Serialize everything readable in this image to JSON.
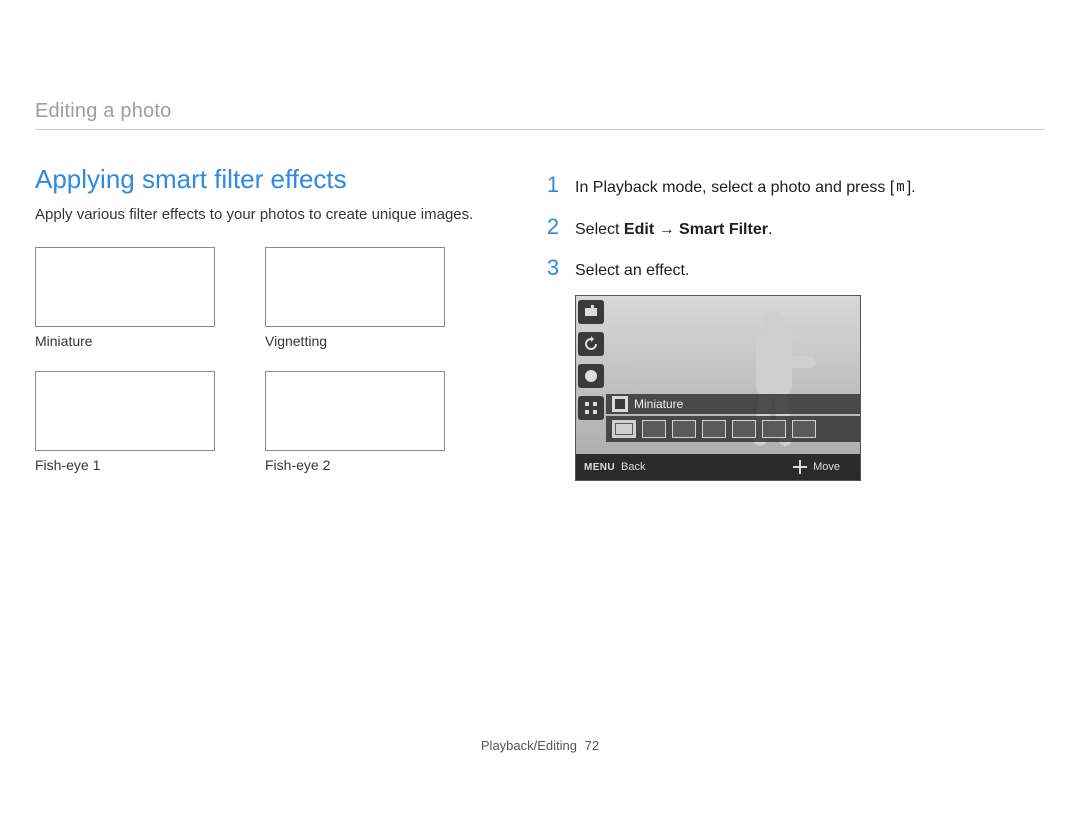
{
  "header": {
    "section": "Editing a photo"
  },
  "left": {
    "title": "Applying smart filter effects",
    "lead": "Apply various filter effects to your photos to create unique images.",
    "swatches": [
      {
        "caption": "Miniature"
      },
      {
        "caption": "Vignetting"
      },
      {
        "caption": "Fish-eye 1"
      },
      {
        "caption": "Fish-eye 2"
      }
    ]
  },
  "right": {
    "steps": {
      "s1": {
        "num": "1",
        "pre": "In Playback mode, select a photo and press [",
        "icon": "m",
        "post": "]."
      },
      "s2": {
        "num": "2",
        "pre": "Select ",
        "b1": "Edit",
        "arrow": " → ",
        "b2": "Smart Filter",
        "post": "."
      },
      "s3": {
        "num": "3",
        "text": "Select an effect."
      }
    },
    "lcd": {
      "label": "Miniature",
      "footer": {
        "menu": "MENU",
        "back": "Back",
        "move": "Move"
      }
    }
  },
  "footer": {
    "chapter": "Playback/Editing",
    "page": "72"
  }
}
